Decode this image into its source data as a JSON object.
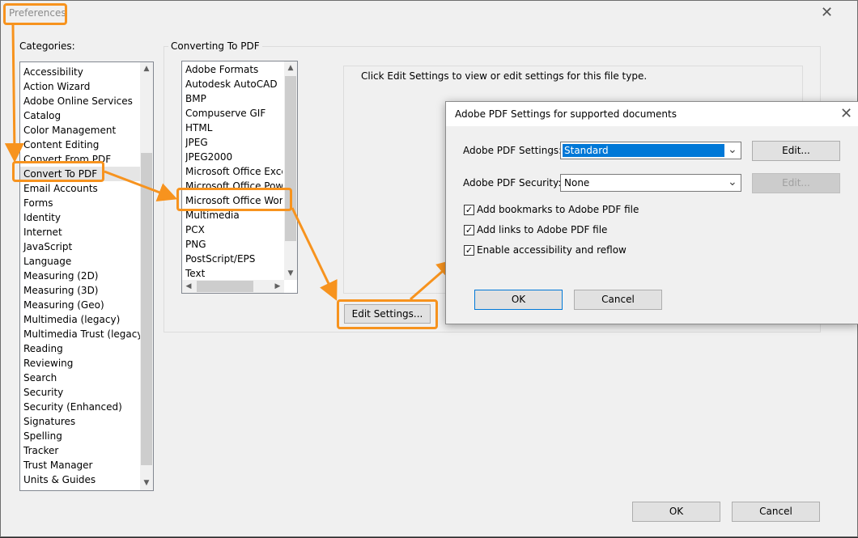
{
  "window": {
    "title": "Preferences",
    "close_glyph": "✕"
  },
  "categories": {
    "label": "Categories:",
    "items": [
      "Accessibility",
      "Action Wizard",
      "Adobe Online Services",
      "Catalog",
      "Color Management",
      "Content Editing",
      "Convert From PDF",
      "Convert To PDF",
      "Email Accounts",
      "Forms",
      "Identity",
      "Internet",
      "JavaScript",
      "Language",
      "Measuring (2D)",
      "Measuring (3D)",
      "Measuring (Geo)",
      "Multimedia (legacy)",
      "Multimedia Trust (legacy)",
      "Reading",
      "Reviewing",
      "Search",
      "Security",
      "Security (Enhanced)",
      "Signatures",
      "Spelling",
      "Tracker",
      "Trust Manager",
      "Units & Guides"
    ],
    "selected": "Convert To PDF"
  },
  "converting": {
    "group_label": "Converting To PDF",
    "formats": [
      "Adobe Formats",
      "Autodesk AutoCAD",
      "BMP",
      "Compuserve GIF",
      "HTML",
      "JPEG",
      "JPEG2000",
      "Microsoft Office Excel",
      "Microsoft Office PowerPoint",
      "Microsoft Office Word",
      "Multimedia",
      "PCX",
      "PNG",
      "PostScript/EPS",
      "Text"
    ],
    "selected": "Microsoft Office Word",
    "hint": "Click Edit Settings to view or edit settings for this file type.",
    "edit_settings_label": "Edit Settings..."
  },
  "footer": {
    "ok_label": "OK",
    "cancel_label": "Cancel"
  },
  "dialog": {
    "title": "Adobe PDF Settings for supported documents",
    "close_glyph": "✕",
    "pdf_settings_label": "Adobe PDF Settings:",
    "pdf_settings_value": "Standard",
    "pdf_security_label": "Adobe PDF Security:",
    "pdf_security_value": "None",
    "edit_label": "Edit...",
    "edit_security_label": "Edit...",
    "checkboxes": [
      {
        "label": "Add bookmarks to Adobe PDF file",
        "checked": true
      },
      {
        "label": "Add links to Adobe PDF file",
        "checked": true
      },
      {
        "label": "Enable accessibility and reflow",
        "checked": true
      }
    ],
    "ok_label": "OK",
    "cancel_label": "Cancel"
  },
  "colors": {
    "highlight_orange": "#f7931e",
    "selection_blue": "#0078d7"
  },
  "glyphs": {
    "scroll_up": "▲",
    "scroll_down": "▼",
    "scroll_left": "◀",
    "scroll_right": "▶",
    "dropdown": "⌄",
    "check": "✓"
  }
}
